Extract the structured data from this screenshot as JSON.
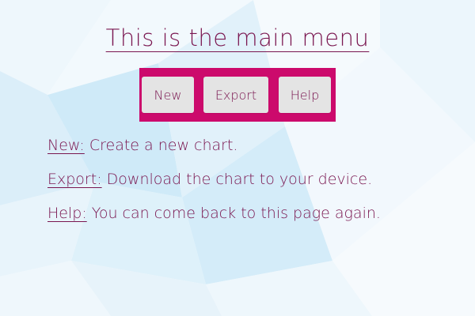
{
  "menu": {
    "title": "This is the main menu",
    "buttons": [
      {
        "label": "New"
      },
      {
        "label": "Export"
      },
      {
        "label": "Help"
      }
    ],
    "descriptions": [
      {
        "key": "New:",
        "text": " Create a new chart."
      },
      {
        "key": "Export:",
        "text": " Download the chart to your device."
      },
      {
        "key": "Help:",
        "text": " You can come back to this page again."
      }
    ]
  },
  "colors": {
    "accent": "#cc0a6c",
    "text": "#7a1650",
    "button_bg": "#e4e4e4"
  }
}
